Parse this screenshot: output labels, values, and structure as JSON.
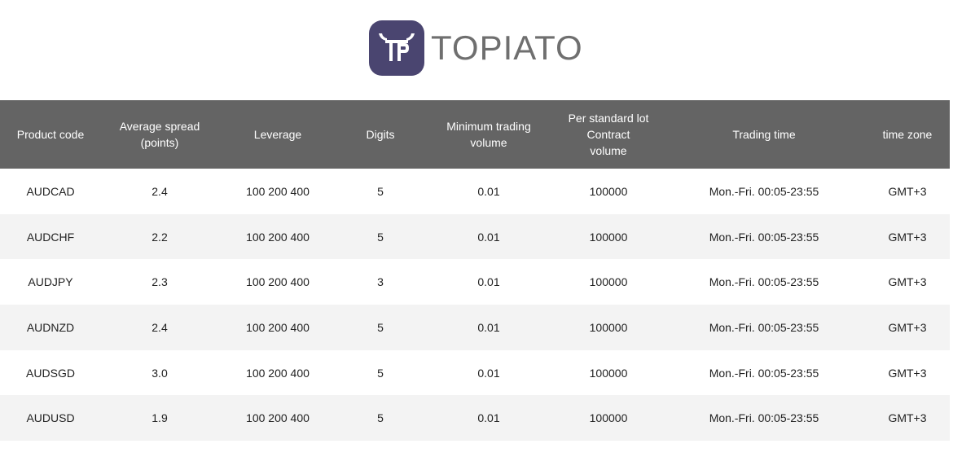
{
  "brand": {
    "name": "TOPIATO",
    "logo_icon": "topiato-bull-logo-icon",
    "logo_color": "#4a4570"
  },
  "colors": {
    "header_bg": "#646464",
    "header_text": "#ffffff",
    "row_alt_bg": "#f3f3f3"
  },
  "table": {
    "headers": [
      [
        "Product code"
      ],
      [
        "Average spread",
        "(points)"
      ],
      [
        "Leverage"
      ],
      [
        "Digits"
      ],
      [
        "Minimum trading",
        "volume"
      ],
      [
        "Per standard lot",
        "Contract",
        "volume"
      ],
      [
        "Trading time"
      ],
      [
        "time zone"
      ]
    ],
    "rows": [
      [
        "AUDCAD",
        "2.4",
        "100 200 400",
        "5",
        "0.01",
        "100000",
        "Mon.-Fri. 00:05-23:55",
        "GMT+3"
      ],
      [
        "AUDCHF",
        "2.2",
        "100 200 400",
        "5",
        "0.01",
        "100000",
        "Mon.-Fri. 00:05-23:55",
        "GMT+3"
      ],
      [
        "AUDJPY",
        "2.3",
        "100 200 400",
        "3",
        "0.01",
        "100000",
        "Mon.-Fri. 00:05-23:55",
        "GMT+3"
      ],
      [
        "AUDNZD",
        "2.4",
        "100 200 400",
        "5",
        "0.01",
        "100000",
        "Mon.-Fri. 00:05-23:55",
        "GMT+3"
      ],
      [
        "AUDSGD",
        "3.0",
        "100 200 400",
        "5",
        "0.01",
        "100000",
        "Mon.-Fri. 00:05-23:55",
        "GMT+3"
      ],
      [
        "AUDUSD",
        "1.9",
        "100 200 400",
        "5",
        "0.01",
        "100000",
        "Mon.-Fri. 00:05-23:55",
        "GMT+3"
      ]
    ]
  }
}
